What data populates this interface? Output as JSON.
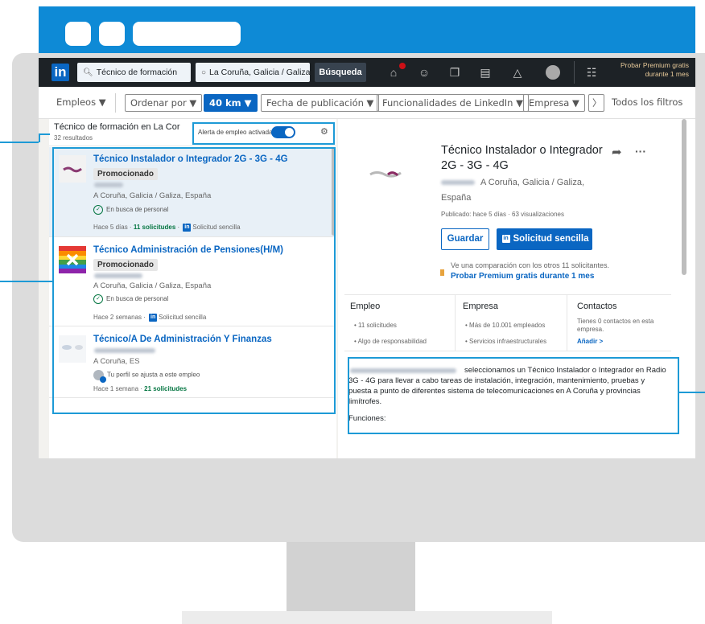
{
  "nav": {
    "logo": "in",
    "search_keywords": "Técnico de formación",
    "search_location": "La Coruña, Galicia / Galiza,",
    "search_button": "Búsqueda",
    "premium": "Probar Premium gratis durante 1 mes"
  },
  "filters": {
    "jobs": "Empleos ▼",
    "sort": "Ordenar por ▼",
    "distance": "40 km ▼",
    "date": "Fecha de publicación ▼",
    "features": "Funcionalidades de LinkedIn ▼",
    "company": "Empresa ▼",
    "all_filters": "Todos los filtros"
  },
  "results": {
    "title": "Técnico de formación en La Cor",
    "count": "32 resultados",
    "alert_label": "Alerta de empleo activada",
    "alert_on": true,
    "jobs": [
      {
        "title": "Técnico Instalador o Integrador 2G - 3G - 4G",
        "promoted": "Promocionado",
        "location": "A Coruña, Galicia / Galiza, España",
        "insight": "En busca de personal",
        "posted": "Hace 5 días",
        "applicants": "11 solicitudes",
        "easy_apply": "Solicitud sencilla"
      },
      {
        "title": "Técnico Administración de Pensiones(H/M)",
        "promoted": "Promocionado",
        "location": "A Coruña, Galicia / Galiza, España",
        "insight": "En busca de personal",
        "posted": "Hace 2 semanas",
        "easy_apply": "Solicitud sencilla"
      },
      {
        "title": "Técnico/A De Administración Y Finanzas",
        "location": "A Coruña, ES",
        "insight": "Tu perfil se ajusta a este empleo",
        "posted": "Hace 1 semana",
        "applicants": "21 solicitudes"
      }
    ]
  },
  "detail": {
    "title": "Técnico Instalador o Integrador 2G - 3G - 4G",
    "location": "A Coruña, Galicia / Galiza,",
    "location_cont": "España",
    "meta": "Publicado: hace 5 días · 63 visualizaciones",
    "save": "Guardar",
    "apply": "Solicitud sencilla",
    "compare_text": "Ve una comparación con los otros 11 solicitantes.",
    "compare_link": "Probar Premium gratis durante 1 mes",
    "columns": {
      "job": {
        "head": "Empleo",
        "items": [
          "11 solicitudes",
          "Algo de responsabilidad"
        ]
      },
      "company": {
        "head": "Empresa",
        "items": [
          "Más de 10.001 empleados",
          "Servicios infraestructurales"
        ]
      },
      "contacts": {
        "head": "Contactos",
        "text": "Tienes 0 contactos en esta empresa.",
        "link": "Añadir >"
      }
    },
    "description": "seleccionamos un Técnico Instalador o Integrador en Radio 3G - 4G para llevar a cabo tareas de instalación, integración, mantenimiento, pruebas y puesta a punto de diferentes sistema de telecomunicaciones en A Coruña y provincias limítrofes.",
    "functions": "Funciones:"
  },
  "colors": {
    "accent": "#0a66c2",
    "callout": "#1d9ad6",
    "browser_bar": "#0e8ad6",
    "nav_bg": "#1d2226"
  }
}
